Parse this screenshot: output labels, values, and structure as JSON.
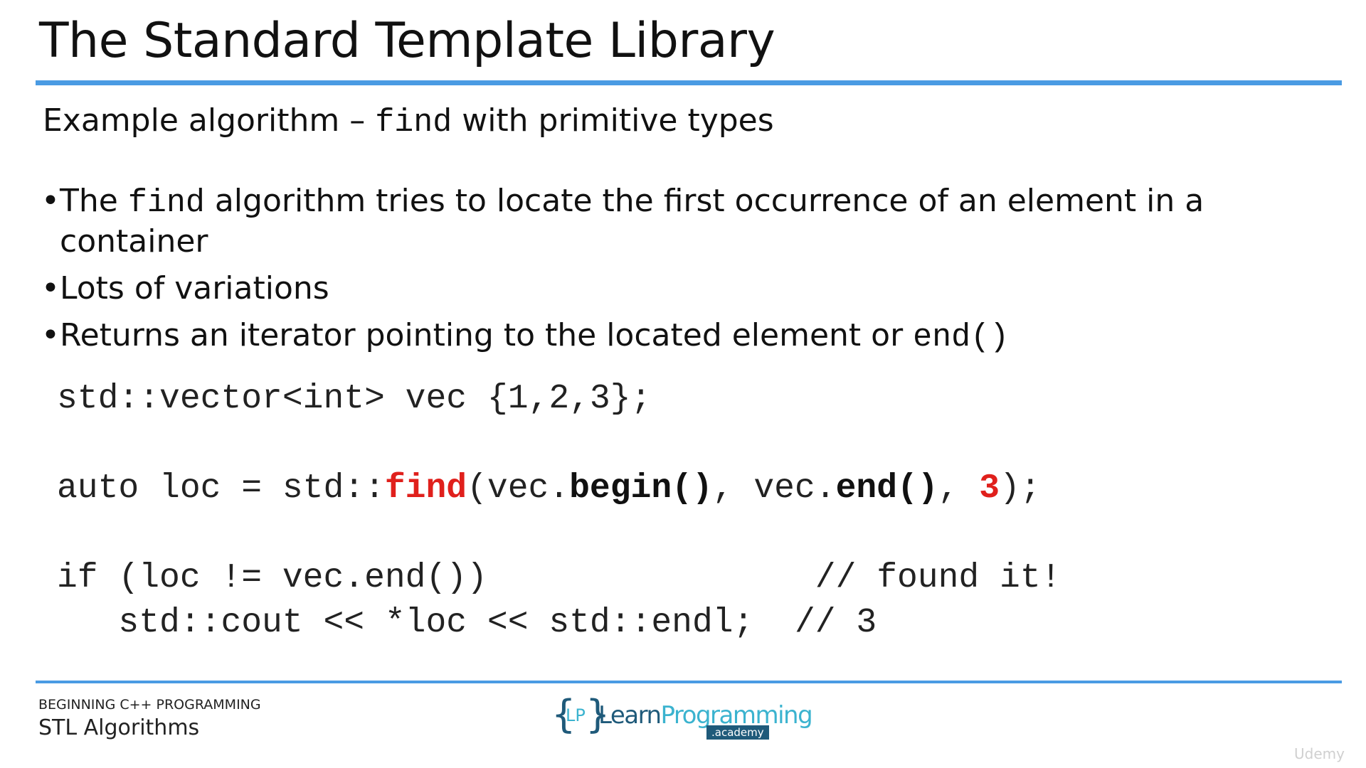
{
  "slide": {
    "title": "The Standard Template Library",
    "subtitle": {
      "prefix": "Example algorithm – ",
      "code": "find",
      "suffix": " with primitive types"
    }
  },
  "bullets": [
    {
      "prefix": "The ",
      "code": "find",
      "suffix": " algorithm tries to locate the first occurrence of an element in a container"
    },
    {
      "text": "Lots of variations"
    },
    {
      "prefix": "Returns an iterator pointing to the located element or ",
      "code": "end()"
    }
  ],
  "code": {
    "line1": "std::vector<int> vec {1,2,3};",
    "line2": {
      "a": "auto loc = std::",
      "find": "find",
      "b": "(vec.",
      "begin": "begin()",
      "c": ", vec.",
      "end": "end()",
      "d": ", ",
      "value": "3",
      "e": ");"
    },
    "line3": "if (loc != vec.end())                // found it!",
    "line4": "   std::cout << *loc << std::endl;  // 3"
  },
  "footer": {
    "course": "BEGINNING C++ PROGRAMMING",
    "topic": "STL Algorithms"
  },
  "logo": {
    "lp": "LP",
    "word_part1": "Learn",
    "word_part2": "Programming",
    "academy": ".academy"
  },
  "watermark": "Udemy",
  "colors": {
    "rule": "#4a9be3",
    "highlight": "#e0201c"
  }
}
